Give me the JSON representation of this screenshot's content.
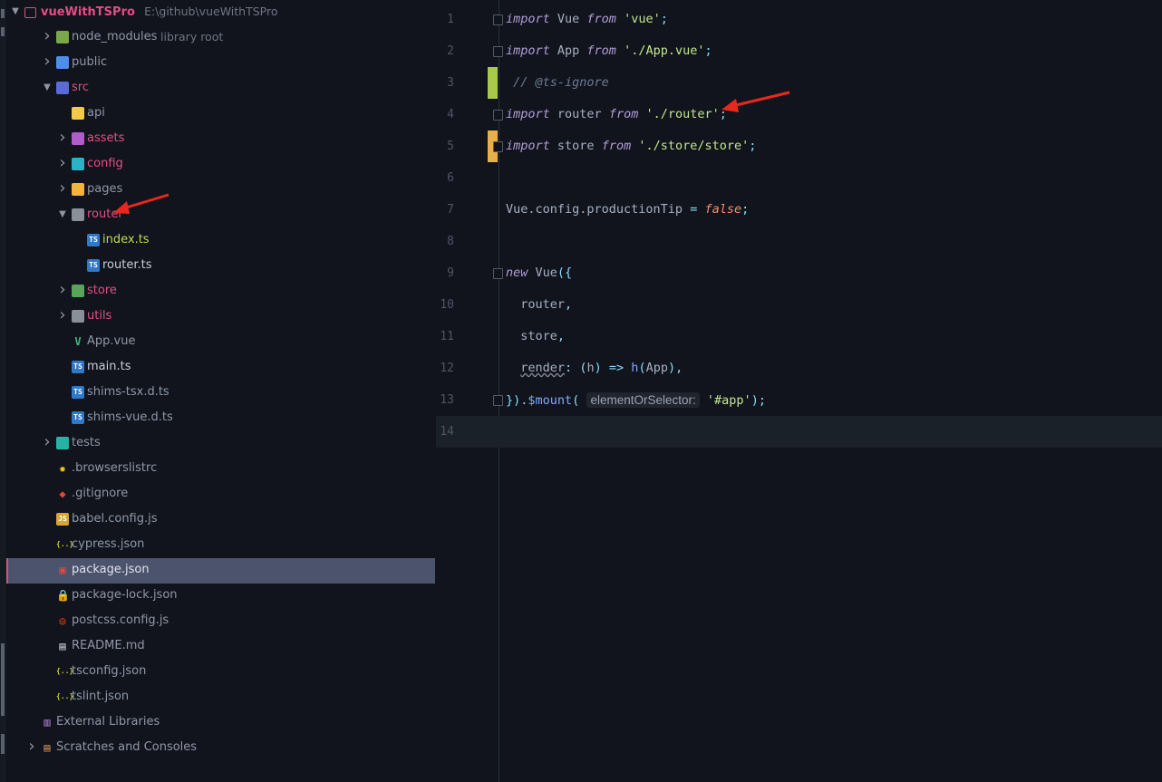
{
  "project": {
    "name": "vueWithTSPro",
    "path": "E:\\github\\vueWithTSPro"
  },
  "tree": [
    {
      "label": "node_modules",
      "sub": "library root",
      "depth": 1,
      "arrow": "right",
      "icon": "folder-library-icon",
      "color": "c-gray",
      "iconBg": "#7aa74a"
    },
    {
      "label": "public",
      "depth": 1,
      "arrow": "right",
      "icon": "folder-public-icon",
      "color": "c-gray",
      "iconBg": "#4f8ee8"
    },
    {
      "label": "src",
      "depth": 1,
      "arrow": "down",
      "icon": "folder-src-icon",
      "color": "c-pink",
      "iconBg": "#5a6bd6"
    },
    {
      "label": "api",
      "depth": 2,
      "arrow": "",
      "icon": "folder-api-icon",
      "color": "c-gray",
      "iconBg": "#f2c94c"
    },
    {
      "label": "assets",
      "depth": 2,
      "arrow": "right",
      "icon": "folder-assets-icon",
      "color": "c-pink",
      "iconBg": "#b05cc9"
    },
    {
      "label": "config",
      "depth": 2,
      "arrow": "right",
      "icon": "folder-config-icon",
      "color": "c-pink",
      "iconBg": "#2bb2c5"
    },
    {
      "label": "pages",
      "depth": 2,
      "arrow": "right",
      "icon": "folder-pages-icon",
      "color": "c-gray",
      "iconBg": "#f2b53a"
    },
    {
      "label": "router",
      "depth": 2,
      "arrow": "down",
      "icon": "folder-router-icon",
      "color": "c-pink",
      "iconBg": "#8a9099"
    },
    {
      "label": "index.ts",
      "depth": 3,
      "arrow": "",
      "icon": "typescript-file-icon",
      "color": "c-green",
      "iconBg": "#3178c6",
      "iconText": "TS"
    },
    {
      "label": "router.ts",
      "depth": 3,
      "arrow": "",
      "icon": "typescript-file-icon",
      "color": "c-white",
      "iconBg": "#3178c6",
      "iconText": "TS"
    },
    {
      "label": "store",
      "depth": 2,
      "arrow": "right",
      "icon": "folder-store-icon",
      "color": "c-pink",
      "iconBg": "#5aa35a"
    },
    {
      "label": "utils",
      "depth": 2,
      "arrow": "right",
      "icon": "folder-utils-icon",
      "color": "c-pink",
      "iconBg": "#8a9099"
    },
    {
      "label": "App.vue",
      "depth": 2,
      "arrow": "",
      "icon": "vue-file-icon",
      "color": "c-gray",
      "iconBg": "transparent",
      "iconText": "V"
    },
    {
      "label": "main.ts",
      "depth": 2,
      "arrow": "",
      "icon": "typescript-file-icon",
      "color": "c-white",
      "iconBg": "#3178c6",
      "iconText": "TS"
    },
    {
      "label": "shims-tsx.d.ts",
      "depth": 2,
      "arrow": "",
      "icon": "typescript-file-icon",
      "color": "c-gray",
      "iconBg": "#3178c6",
      "iconText": "TS"
    },
    {
      "label": "shims-vue.d.ts",
      "depth": 2,
      "arrow": "",
      "icon": "typescript-file-icon",
      "color": "c-gray",
      "iconBg": "#3178c6",
      "iconText": "TS"
    },
    {
      "label": "tests",
      "depth": 1,
      "arrow": "right",
      "icon": "folder-tests-icon",
      "color": "c-gray",
      "iconBg": "#26b3a3"
    },
    {
      "label": ".browserslistrc",
      "depth": 1,
      "arrow": "",
      "icon": "gear-icon",
      "color": "c-gray",
      "iconBg": "transparent",
      "iconText": "✹"
    },
    {
      "label": ".gitignore",
      "depth": 1,
      "arrow": "",
      "icon": "git-icon",
      "color": "c-gray",
      "iconBg": "transparent",
      "iconText": "◆"
    },
    {
      "label": "babel.config.js",
      "depth": 1,
      "arrow": "",
      "icon": "javascript-file-icon",
      "color": "c-gray",
      "iconBg": "#d6a43a",
      "iconText": "JS"
    },
    {
      "label": "cypress.json",
      "depth": 1,
      "arrow": "",
      "icon": "json-file-icon",
      "color": "c-gray",
      "iconBg": "transparent",
      "iconText": "{..}"
    },
    {
      "label": "package.json",
      "depth": 1,
      "arrow": "",
      "icon": "npm-file-icon",
      "color": "c-bright",
      "iconBg": "transparent",
      "iconText": "▣",
      "selected": true
    },
    {
      "label": "package-lock.json",
      "depth": 1,
      "arrow": "",
      "icon": "lock-icon",
      "color": "c-gray",
      "iconBg": "transparent",
      "iconText": "🔒"
    },
    {
      "label": "postcss.config.js",
      "depth": 1,
      "arrow": "",
      "icon": "postcss-file-icon",
      "color": "c-gray",
      "iconBg": "transparent",
      "iconText": "◎"
    },
    {
      "label": "README.md",
      "depth": 1,
      "arrow": "",
      "icon": "readme-file-icon",
      "color": "c-gray",
      "iconBg": "transparent",
      "iconText": "▤"
    },
    {
      "label": "tsconfig.json",
      "depth": 1,
      "arrow": "",
      "icon": "json-file-icon",
      "color": "c-gray",
      "iconBg": "transparent",
      "iconText": "{..}"
    },
    {
      "label": "tslint.json",
      "depth": 1,
      "arrow": "",
      "icon": "json-file-icon",
      "color": "c-gray",
      "iconBg": "transparent",
      "iconText": "{..}"
    },
    {
      "label": "External Libraries",
      "depth": 0,
      "arrow": "",
      "icon": "library-icon",
      "color": "c-gray",
      "iconBg": "transparent",
      "iconText": "▥"
    },
    {
      "label": "Scratches and Consoles",
      "depth": 0,
      "arrow": "right",
      "icon": "scratches-icon",
      "color": "c-gray",
      "iconBg": "transparent",
      "iconText": "▤"
    }
  ],
  "editor": {
    "current_line": 14,
    "lines": [
      {
        "n": "1",
        "fold": true,
        "mark": "",
        "html": "<span class=\"kw\">import</span> Vue <span class=\"kw\">from</span> <span class=\"str\">'vue'</span><span class=\"pun\">;</span>"
      },
      {
        "n": "2",
        "fold": true,
        "mark": "",
        "html": "<span class=\"kw\">import</span> App <span class=\"kw\">from</span> <span class=\"str\">'./App.vue'</span><span class=\"pun\">;</span>"
      },
      {
        "n": "3",
        "fold": false,
        "mark": "#a8c94a",
        "html": " <span class=\"cm\">// @ts-ignore</span>"
      },
      {
        "n": "4",
        "fold": true,
        "mark": "",
        "html": "<span class=\"kw\">import</span> router <span class=\"kw\">from</span> <span class=\"str\">'./router'</span><span class=\"pun\">;</span>"
      },
      {
        "n": "5",
        "fold": true,
        "mark": "#e8b04a",
        "html": "<span class=\"kw\">import</span> store <span class=\"kw\">from</span> <span class=\"str\">'./store/store'</span><span class=\"pun\">;</span>"
      },
      {
        "n": "6",
        "fold": false,
        "mark": "",
        "html": ""
      },
      {
        "n": "7",
        "fold": false,
        "mark": "",
        "html": "Vue.config.productionTip <span class=\"pun\">=</span> <span class=\"bool\">false</span><span class=\"pun\">;</span>"
      },
      {
        "n": "8",
        "fold": false,
        "mark": "",
        "html": ""
      },
      {
        "n": "9",
        "fold": true,
        "mark": "",
        "html": "<span class=\"kw\">new</span> Vue<span class=\"pun\">({</span>"
      },
      {
        "n": "10",
        "fold": false,
        "mark": "",
        "html": "  router<span class=\"pun\">,</span>"
      },
      {
        "n": "11",
        "fold": false,
        "mark": "",
        "html": "  store<span class=\"pun\">,</span>"
      },
      {
        "n": "12",
        "fold": false,
        "mark": "",
        "html": "  <span class=\"warn\">render</span><span class=\"pun\">:</span> <span class=\"pun\">(</span>h<span class=\"pun\">)</span> <span class=\"pun\">=></span> <span class=\"fn\">h</span><span class=\"pun\">(</span>App<span class=\"pun\">),</span>"
      },
      {
        "n": "13",
        "fold": true,
        "mark": "",
        "html": "<span class=\"pun\">}).</span><span class=\"fn\">$mount</span><span class=\"pun\">(</span> <span class=\"hint\">elementOrSelector:</span> <span class=\"str\">'#app'</span><span class=\"pun\">);</span>"
      },
      {
        "n": "14",
        "fold": false,
        "mark": "",
        "html": ""
      }
    ]
  },
  "colors": {
    "background": "#11141c",
    "selection": "#4c536d",
    "accent_pink": "#e64c86",
    "annotation_arrow": "#e8281e"
  }
}
